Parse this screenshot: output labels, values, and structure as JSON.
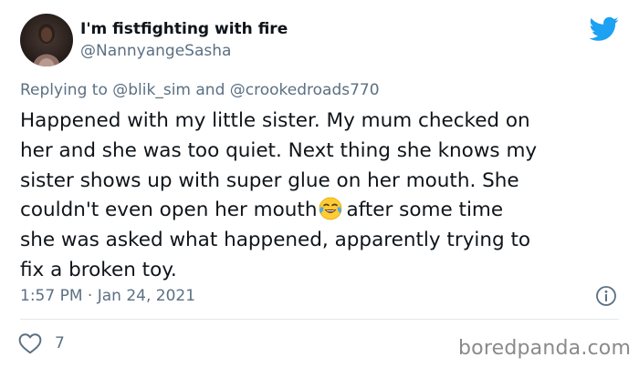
{
  "user": {
    "display_name": "I'm fistfighting with fire",
    "handle": "@NannyangeSasha"
  },
  "reply": {
    "prefix": "Replying to ",
    "mention_1": "@blik_sim",
    "conjunction": " and ",
    "mention_2": "@crookedroads770"
  },
  "tweet": {
    "lines": [
      "Happened with my little sister. My mum checked on",
      "her and she was too quiet. Next thing she knows my",
      "sister shows up with super glue on her mouth. She",
      "couldn't even open her mouth",
      "after some time",
      "she was asked what happened, apparently trying to",
      "fix a broken toy."
    ],
    "emoji": "face-with-tears-of-joy-icon"
  },
  "meta": {
    "timestamp": "1:57 PM · Jan 24, 2021"
  },
  "actions": {
    "like_count": "7"
  },
  "watermark": "boredpanda.com",
  "colors": {
    "twitter_blue": "#1da1f2",
    "secondary_text": "#5b7083",
    "primary_text": "#0f1419",
    "divider": "#e1e8ed"
  },
  "icons": [
    "avatar",
    "twitter-bird-icon",
    "face-with-tears-of-joy-icon",
    "info-icon",
    "heart-icon"
  ]
}
